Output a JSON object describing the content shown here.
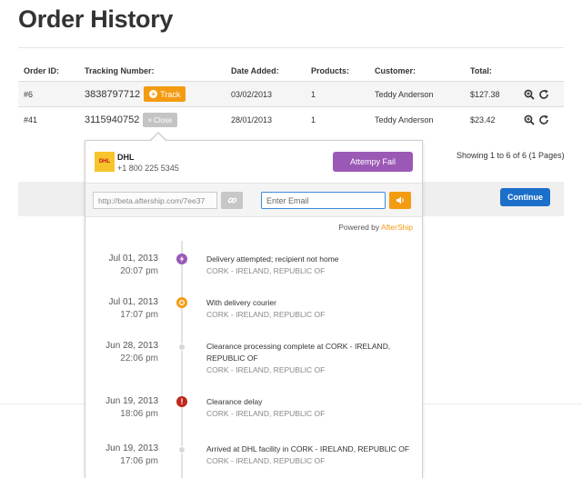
{
  "page": {
    "title": "Order History"
  },
  "table": {
    "headers": {
      "id": "Order ID:",
      "tracking": "Tracking Number:",
      "date": "Date Added:",
      "products": "Products:",
      "customer": "Customer:",
      "total": "Total:"
    },
    "rows": [
      {
        "id": "#6",
        "tracking": "3838797712",
        "button": "Track",
        "date": "03/02/2013",
        "products": "1",
        "customer": "Teddy Anderson",
        "total": "$127.38"
      },
      {
        "id": "#41",
        "tracking": "3115940752",
        "button": "Close",
        "date": "28/01/2013",
        "products": "1",
        "customer": "Teddy Anderson",
        "total": "$23.42"
      }
    ]
  },
  "pagination": {
    "showing": "Showing 1 to 6 of 6 (1 Pages)"
  },
  "continue_label": "Continue",
  "popup": {
    "carrier": {
      "logo_text": "DHL",
      "name": "DHL",
      "phone": "+1 800 225 5345"
    },
    "status_label": "Attempy Fail",
    "share_url": "http://beta.aftership.com/7ee37",
    "email_placeholder": "Enter Email",
    "powered_by": {
      "prefix": "Powered by ",
      "brand": "AfterShip"
    },
    "checkpoints": [
      {
        "date": "Jul 01, 2013",
        "time": "20:07 pm",
        "message": "Delivery attempted; recipient not home",
        "location": "CORK - IRELAND, REPUBLIC OF",
        "status": "attempt-fail",
        "color": "#9b59b6"
      },
      {
        "date": "Jul 01, 2013",
        "time": "17:07 pm",
        "message": "With delivery courier",
        "location": "CORK - IRELAND, REPUBLIC OF",
        "status": "out-for-delivery",
        "color": "#f39c12"
      },
      {
        "date": "Jun 28, 2013",
        "time": "22:06 pm",
        "message": "Clearance processing complete at CORK - IRELAND, REPUBLIC OF",
        "location": "CORK - IRELAND, REPUBLIC OF",
        "status": "in-transit",
        "color": "#d0d0d0"
      },
      {
        "date": "Jun 19, 2013",
        "time": "18:06 pm",
        "message": "Clearance delay",
        "location": "CORK - IRELAND, REPUBLIC OF",
        "status": "exception",
        "color": "#c0271d"
      },
      {
        "date": "Jun 19, 2013",
        "time": "17:06 pm",
        "message": "Arrived at DHL facility in CORK - IRELAND, REPUBLIC OF",
        "location": "CORK - IRELAND, REPUBLIC OF",
        "status": "in-transit",
        "color": "#d0d0d0"
      }
    ]
  },
  "colors": {
    "track_button": "#f39c12",
    "continue_button": "#1c6fc9",
    "status_pill": "#9b59b6"
  }
}
